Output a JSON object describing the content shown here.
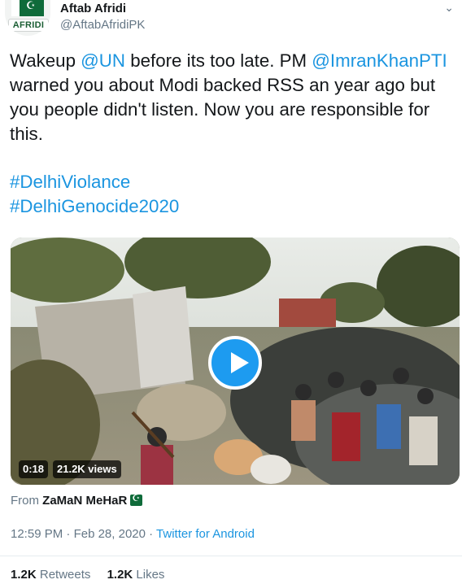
{
  "author": {
    "name": "Aftab Afridi",
    "handle": "@AftabAfridiPK",
    "avatar_badge": "AFRIDI",
    "avatar_icon": "pakistan-flag-icon"
  },
  "menu_icon": "chevron-down-icon",
  "tweet": {
    "t1": "Wakeup ",
    "m1": "@UN",
    "t2": " before its too late. PM ",
    "m2": "@ImranKhanPTI",
    "t3": " warned you about Modi backed RSS an year ago but you people didn't listen. Now you are responsible for this.",
    "hashtags": [
      "#DelhiViolance",
      "#DelhiGenocide2020"
    ]
  },
  "video": {
    "duration": "0:18",
    "views": "21.2K views",
    "play_icon": "play-icon"
  },
  "from": {
    "prefix": "From ",
    "source": "ZaMaN MeHaR",
    "flag_icon": "pakistan-flag-icon"
  },
  "meta": {
    "time": "12:59 PM",
    "separator1": " · ",
    "date": "Feb 28, 2020",
    "separator2": " · ",
    "app": "Twitter for Android"
  },
  "stats": {
    "retweets_count": "1.2K",
    "retweets_label": " Retweets",
    "likes_count": "1.2K",
    "likes_label": " Likes"
  },
  "colors": {
    "link": "#1b95e0",
    "secondary": "#657786",
    "primary_text": "#14171a",
    "play": "#1d9bf0"
  }
}
